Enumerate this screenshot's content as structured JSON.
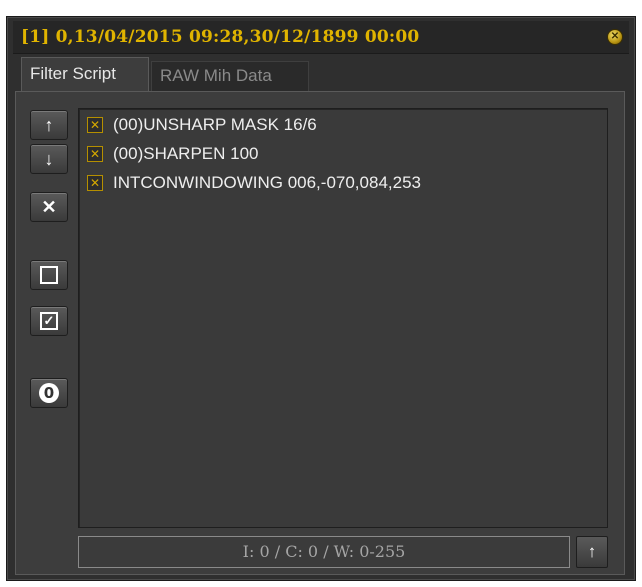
{
  "window": {
    "title": "[1] 0,13/04/2015 09:28,30/12/1899 00:00",
    "close_icon": "close-icon"
  },
  "tabs": [
    {
      "label": "Filter Script",
      "active": true
    },
    {
      "label": "RAW Mih Data",
      "active": false
    }
  ],
  "side_buttons": [
    {
      "name": "move-up",
      "icon": "↑"
    },
    {
      "name": "move-down",
      "icon": "↓"
    },
    {
      "name": "delete",
      "icon": "✕"
    },
    {
      "name": "uncheck-all",
      "icon": ""
    },
    {
      "name": "check-all",
      "icon": "✓"
    },
    {
      "name": "reset",
      "icon": "0"
    }
  ],
  "filters": [
    {
      "label": "(00)UNSHARP MASK 16/6",
      "checked": true,
      "mark": "✕"
    },
    {
      "label": "(00)SHARPEN 100",
      "checked": true,
      "mark": "✕"
    },
    {
      "label": "INTCONWINDOWING 006,-070,084,253",
      "checked": true,
      "mark": "✕"
    }
  ],
  "status": {
    "text": "I: 0 / C: 0 / W: 0-255",
    "button_icon": "↑"
  },
  "colors": {
    "title": "#e0b400",
    "background": "#2f2f2f",
    "checkbox": "#d4a800"
  }
}
